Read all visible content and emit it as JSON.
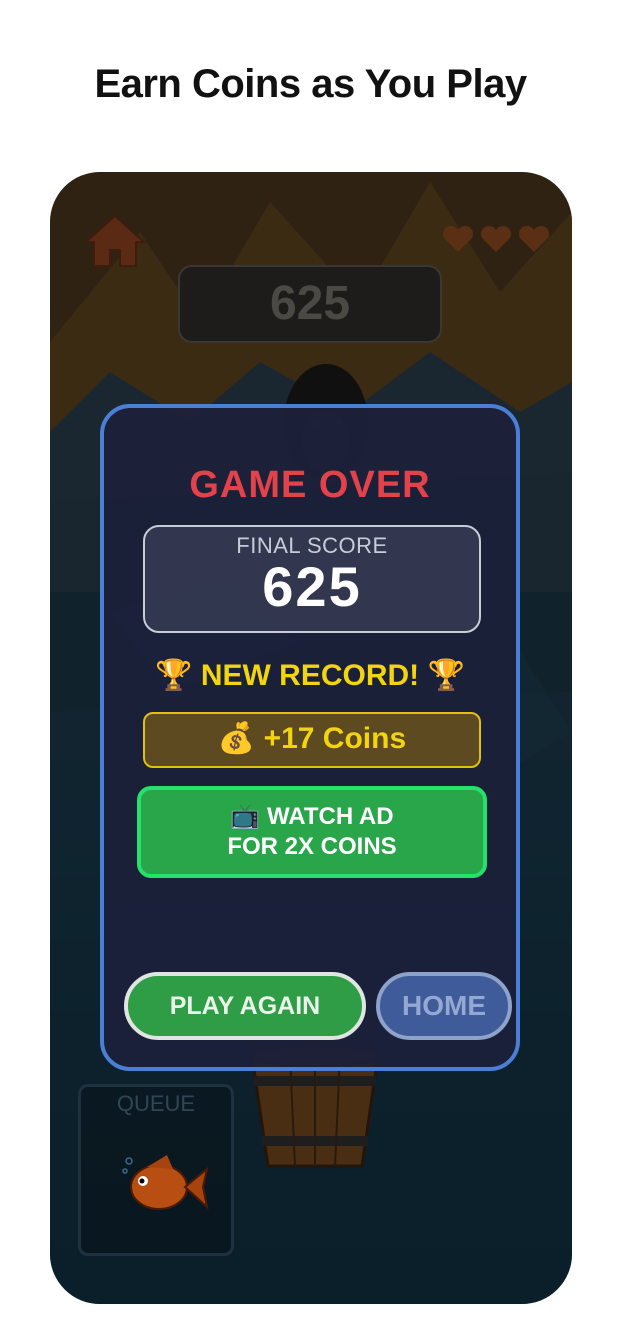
{
  "headline": "Earn Coins as You Play",
  "hud": {
    "score": "625",
    "queue_label": "QUEUE"
  },
  "game_over": {
    "title": "GAME OVER",
    "final_score_label": "FINAL SCORE",
    "final_score_value": "625",
    "record_text": "🏆 NEW RECORD! 🏆",
    "coins_text": "💰 +17 Coins",
    "watch_ad_line1": "📺 WATCH AD",
    "watch_ad_line2": "FOR 2X COINS",
    "play_again_label": "PLAY AGAIN",
    "home_label": "HOME"
  },
  "colors": {
    "panel_border": "#4b7fd6",
    "title": "#e2434a",
    "record": "#f2d40f",
    "watch_ad": "#2aa64a",
    "play_again": "#2f9c46",
    "home": "#3f5b9a"
  },
  "icons": [
    "home-icon",
    "heart-icon",
    "penguin-icon",
    "bucket-icon",
    "fish-icon"
  ]
}
